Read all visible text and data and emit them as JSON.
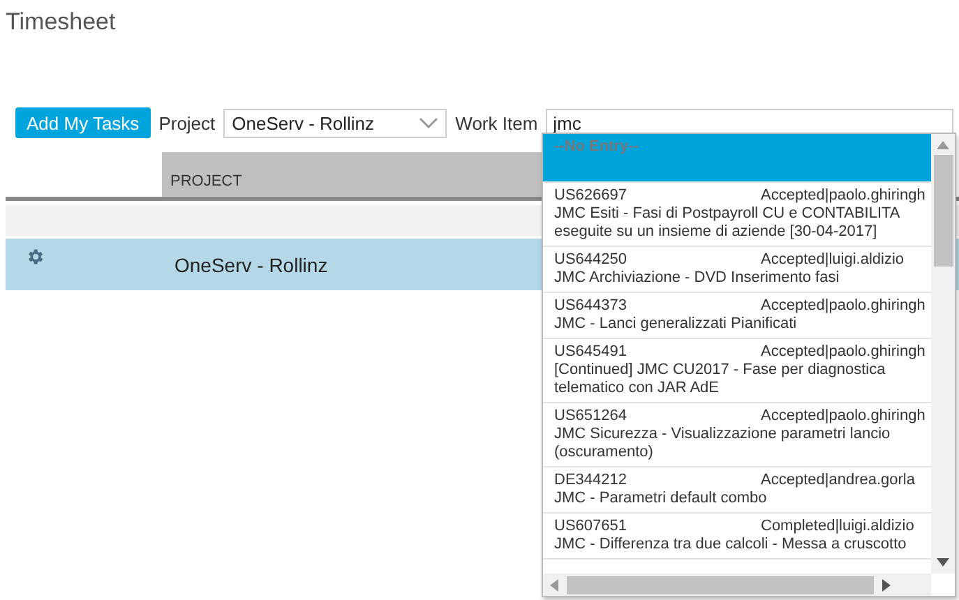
{
  "page": {
    "title": "Timesheet"
  },
  "toolbar": {
    "add_button": "Add My Tasks",
    "project_label": "Project",
    "project_value": "OneServ - Rollinz",
    "work_item_label": "Work Item",
    "work_item_value": "jmc"
  },
  "table": {
    "columns": [
      "PROJECT"
    ],
    "rows": [
      {
        "project": "OneServ - Rollinz",
        "selected": true
      }
    ]
  },
  "dropdown": {
    "items": [
      {
        "kind": "empty",
        "label": "--No Entry--",
        "selected": true
      },
      {
        "kind": "item",
        "id": "US626697",
        "status": "Accepted|paolo.ghiringh",
        "description": "JMC Esiti - Fasi di Postpayroll CU e CONTABILITA eseguite su un insieme di aziende [30-04-2017]",
        "selected": false
      },
      {
        "kind": "item",
        "id": "US644250",
        "status": "Accepted|luigi.aldizio",
        "description": "JMC Archiviazione - DVD Inserimento fasi",
        "selected": false
      },
      {
        "kind": "item",
        "id": "US644373",
        "status": "Accepted|paolo.ghiringh",
        "description": "JMC - Lanci generalizzati Pianificati",
        "selected": false
      },
      {
        "kind": "item",
        "id": "US645491",
        "status": "Accepted|paolo.ghiringh",
        "description": "[Continued] JMC CU2017 - Fase per diagnostica telematico con JAR AdE",
        "selected": false
      },
      {
        "kind": "item",
        "id": "US651264",
        "status": "Accepted|paolo.ghiringh",
        "description": "JMC Sicurezza - Visualizzazione parametri lancio (oscuramento)",
        "selected": false
      },
      {
        "kind": "item",
        "id": "DE344212",
        "status": "Accepted|andrea.gorla",
        "description": "JMC - Parametri default combo",
        "selected": false
      },
      {
        "kind": "item",
        "id": "US607651",
        "status": "Completed|luigi.aldizio",
        "description": "JMC - Differenza tra due calcoli - Messa a cruscotto",
        "selected": false
      }
    ]
  }
}
